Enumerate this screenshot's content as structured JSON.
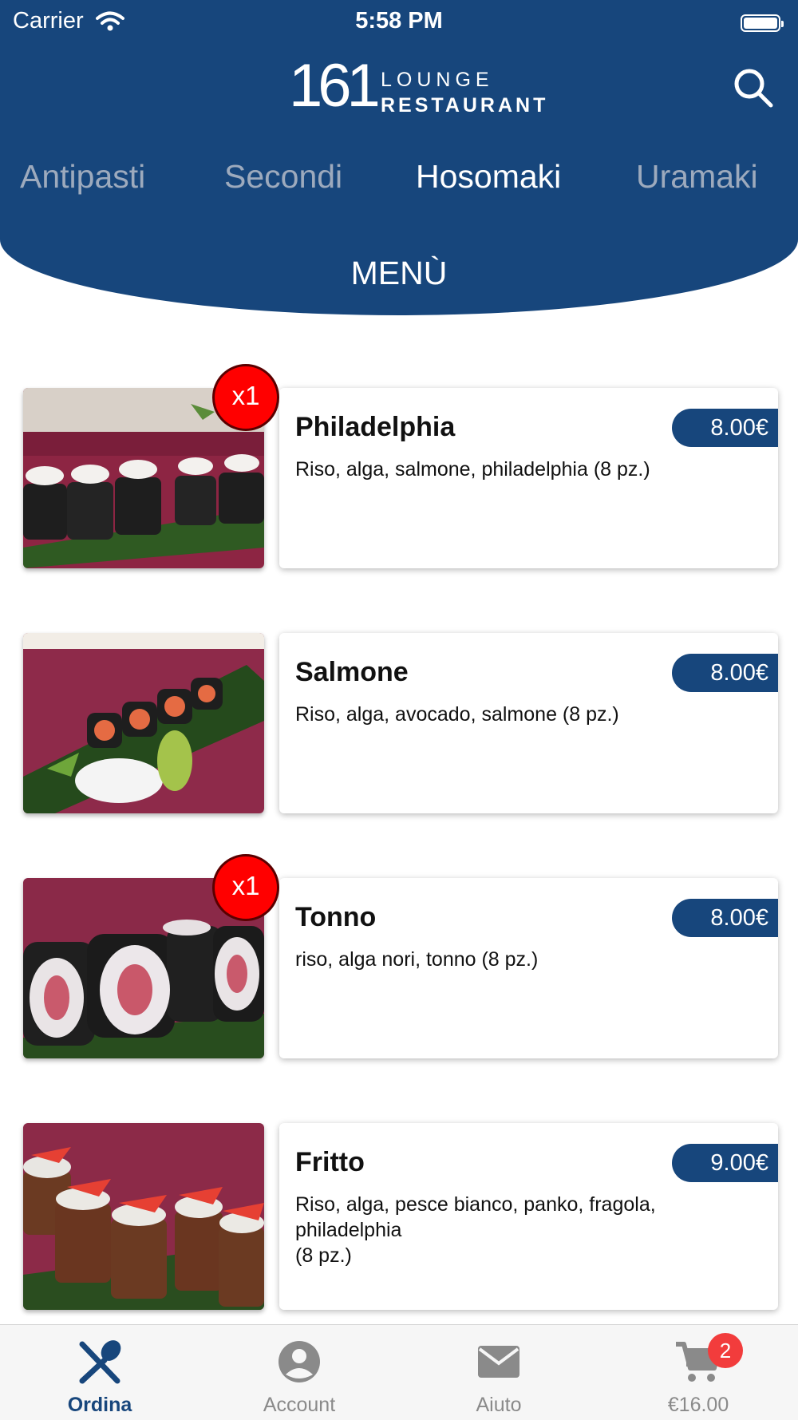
{
  "status_bar": {
    "carrier": "Carrier",
    "time": "5:58 PM"
  },
  "logo": {
    "number": "161",
    "line1": "LOUNGE",
    "line2": "RESTAURANT"
  },
  "categories": [
    "Antipasti",
    "Secondi",
    "Hosomaki",
    "Uramaki"
  ],
  "active_category": "Hosomaki",
  "menu_title": "MENÙ",
  "items": [
    {
      "name": "Philadelphia",
      "description": "Riso, alga, salmone, philadelphia (8 pz.)",
      "price": "8.00€",
      "badge": "x1"
    },
    {
      "name": "Salmone",
      "description": "Riso, alga, avocado, salmone (8 pz.)",
      "price": "8.00€",
      "badge": ""
    },
    {
      "name": "Tonno",
      "description": "riso, alga nori, tonno (8 pz.)",
      "price": "8.00€",
      "badge": "x1"
    },
    {
      "name": "Fritto",
      "description": "Riso, alga, pesce bianco, panko, fragola,\nphiladelphia\n(8 pz.)",
      "price": "9.00€",
      "badge": ""
    }
  ],
  "tabbar": {
    "order": "Ordina",
    "account": "Account",
    "help": "Aiuto",
    "cart_total": "€16.00",
    "cart_count": "2"
  },
  "colors": {
    "primary": "#17467c",
    "badge": "#ff0000"
  }
}
